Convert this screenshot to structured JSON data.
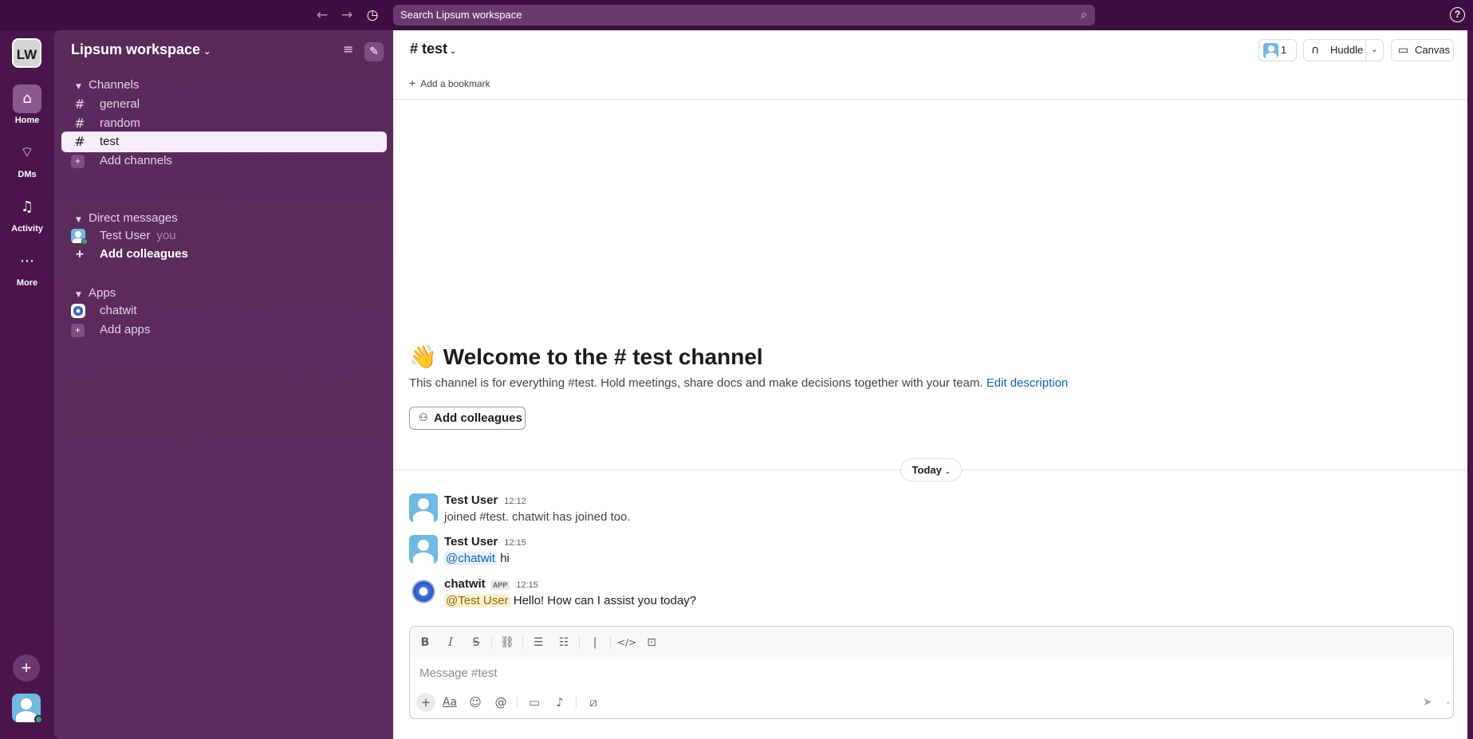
{
  "topbar": {
    "search_placeholder": "Search Lipsum workspace",
    "back_icon": "arrow-left-icon",
    "forward_icon": "arrow-right-icon",
    "history_icon": "clock-icon",
    "help_label": "?"
  },
  "rail": {
    "workspace_initials": "LW",
    "items": [
      {
        "label": "Home",
        "icon": "home-icon",
        "active": true
      },
      {
        "label": "DMs",
        "icon": "dms-icon"
      },
      {
        "label": "Activity",
        "icon": "bell-icon"
      },
      {
        "label": "More",
        "icon": "more-icon"
      }
    ]
  },
  "sidebar": {
    "workspace_name": "Lipsum workspace",
    "channels_header": "Channels",
    "channels": [
      {
        "name": "general"
      },
      {
        "name": "random"
      },
      {
        "name": "test",
        "active": true
      }
    ],
    "add_channels": "Add channels",
    "dm_header": "Direct messages",
    "dms": [
      {
        "name": "Test User",
        "suffix": "you"
      }
    ],
    "add_colleagues": "Add colleagues",
    "apps_header": "Apps",
    "apps": [
      {
        "name": "chatwit"
      }
    ],
    "add_apps": "Add apps"
  },
  "channel": {
    "name": "test",
    "member_count": "1",
    "huddle_label": "Huddle",
    "canvas_label": "Canvas",
    "add_bookmark": "Add a bookmark"
  },
  "welcome": {
    "emoji": "👋",
    "title": "Welcome to the # test channel",
    "description": "This channel is for everything #test. Hold meetings, share docs and make decisions together with your team.",
    "edit_link": "Edit description",
    "add_colleagues_btn": "Add colleagues"
  },
  "date_divider": "Today",
  "messages": [
    {
      "author": "Test User",
      "time": "12:12",
      "text": "joined #test. chatwit has joined too."
    },
    {
      "author": "Test User",
      "time": "12:15",
      "mention": "@chatwit",
      "text": " hi"
    },
    {
      "author": "chatwit",
      "badge": "APP",
      "time": "12:15",
      "mention": "@Test User",
      "text": " Hello! How can I assist you today?"
    }
  ],
  "composer": {
    "placeholder": "Message #test"
  },
  "colors": {
    "aubergine_dark": "#3f0e40",
    "aubergine": "#4a154b",
    "sidebar": "#5b2a5c",
    "active_item": "#f9edf9",
    "link": "#1264a3",
    "online": "#2bac76"
  }
}
